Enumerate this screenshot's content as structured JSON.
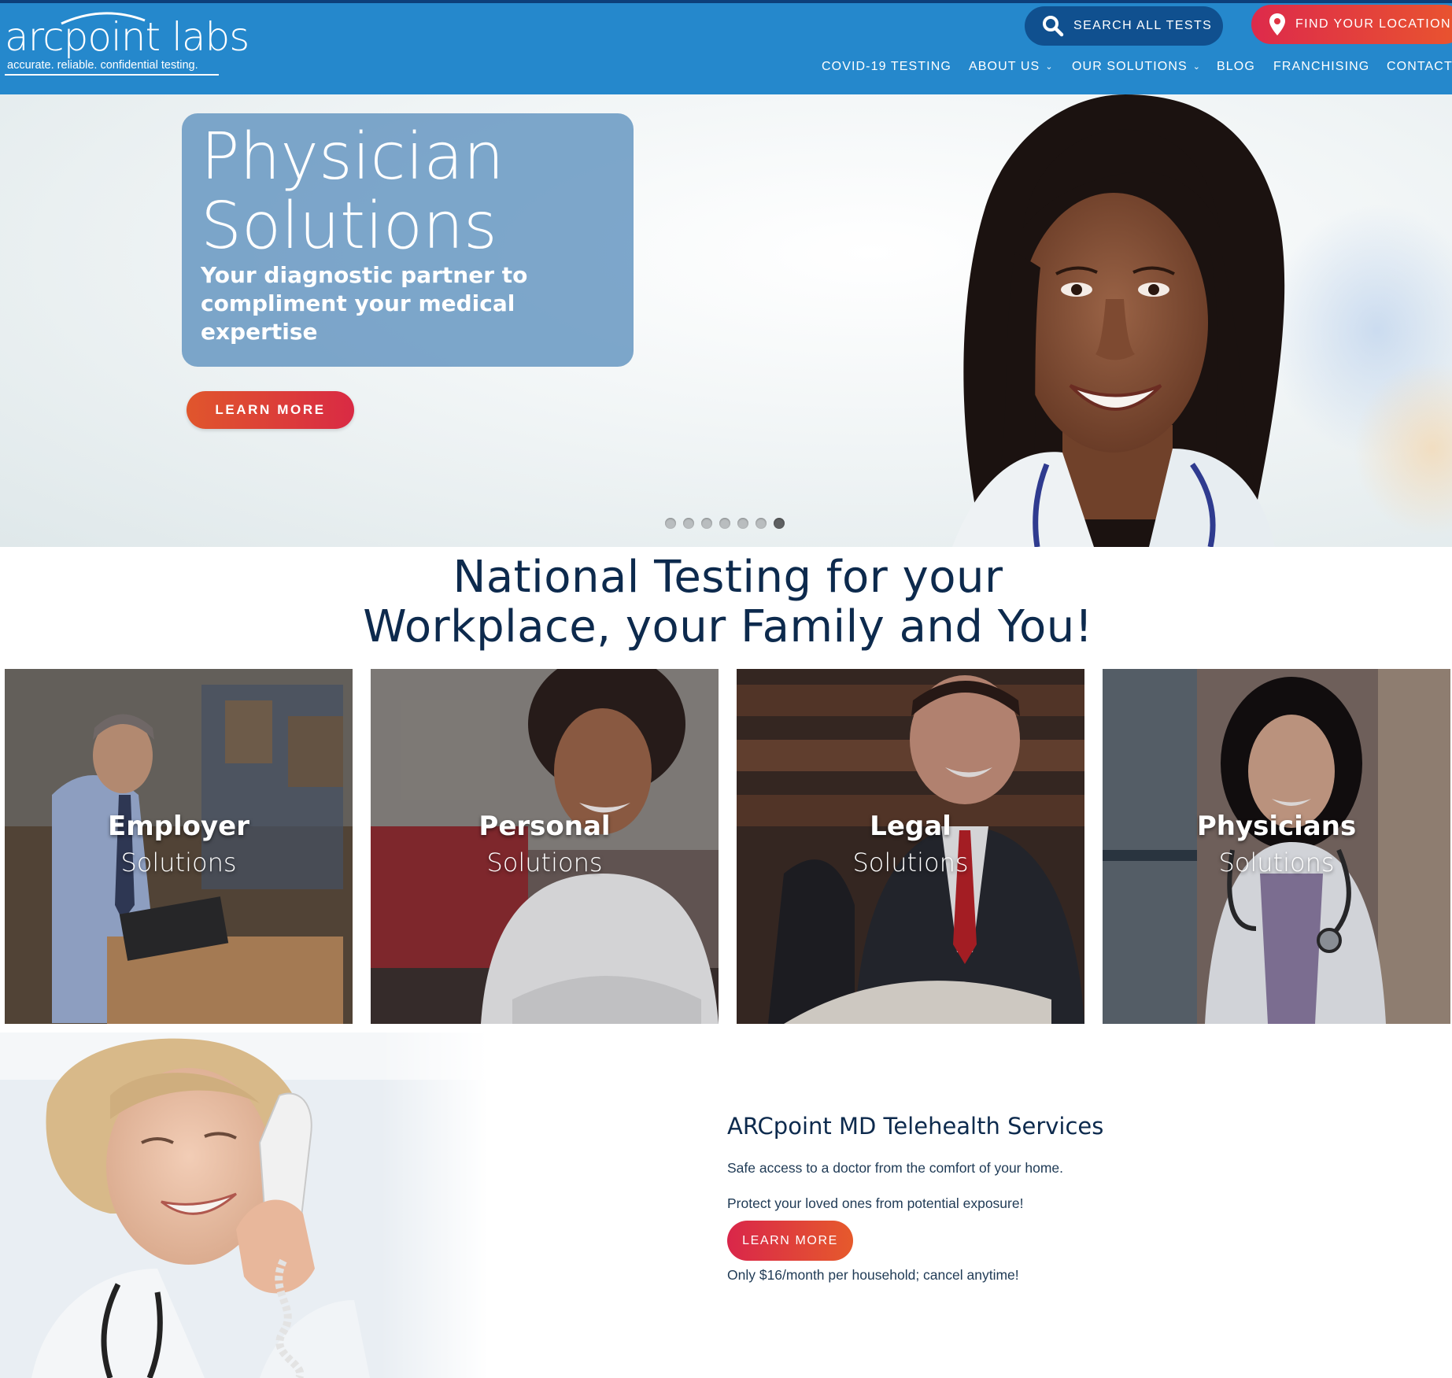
{
  "brand": {
    "logo_text": "arcpoint labs",
    "tagline": "accurate. reliable. confidential testing.",
    "colors": {
      "header_blue": "#2588cc",
      "dark_blue": "#10508f",
      "accent_red": "#dd2a4b",
      "accent_orange": "#e9552e",
      "navy_text": "#0d2a4d"
    }
  },
  "header": {
    "search_label": "SEARCH ALL TESTS",
    "search_icon": "search-icon",
    "location_label": "FIND YOUR LOCATION",
    "location_icon": "map-pin-icon",
    "nav": [
      {
        "label": "COVID-19 TESTING"
      },
      {
        "label": "ABOUT US",
        "chevron": "chevron-down-icon"
      },
      {
        "label": "OUR SOLUTIONS",
        "chevron": "chevron-down-icon"
      },
      {
        "label": "BLOG"
      },
      {
        "label": "FRANCHISING"
      },
      {
        "label": "CONTACT"
      }
    ]
  },
  "hero": {
    "title_line1": "Physician",
    "title_line2": "Solutions",
    "subtitle": "Your diagnostic partner to compliment your medical expertise",
    "cta": "LEARN MORE",
    "slides_total": 7,
    "active_slide": 7
  },
  "headline": {
    "line1": "National Testing for your",
    "line2": "Workplace, your Family and You!"
  },
  "tiles": [
    {
      "title": "Employer",
      "subtitle": "Solutions"
    },
    {
      "title": "Personal",
      "subtitle": "Solutions"
    },
    {
      "title": "Legal",
      "subtitle": "Solutions"
    },
    {
      "title": "Physicians",
      "subtitle": "Solutions"
    }
  ],
  "telehealth": {
    "title": "ARCpoint MD Telehealth Services",
    "line1": "Safe access to a doctor from the comfort of your home.",
    "line2": "Protect your loved ones from potential exposure!",
    "cta": "LEARN MORE",
    "price_note": "Only $16/month per household; cancel anytime!"
  }
}
